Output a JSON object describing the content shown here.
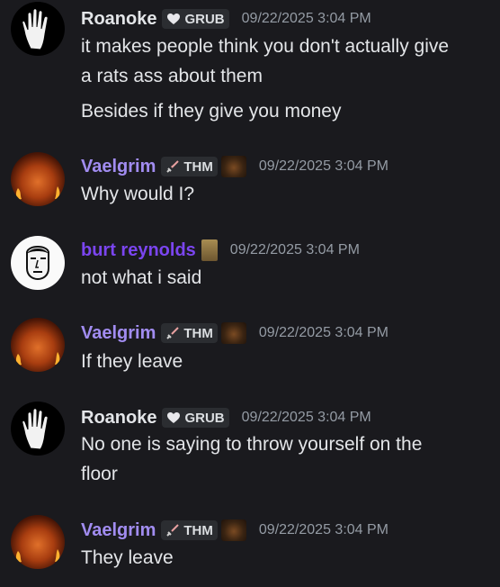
{
  "messages": [
    {
      "author": "Roanoke",
      "author_color": "#e3e5e8",
      "avatar_icon": "white-hand-avatar",
      "tag": {
        "icon": "heart-icon",
        "label": "GRUB"
      },
      "timestamp": "09/22/2025 3:04 PM",
      "lines": [
        "it makes people think you don't actually give",
        "a rats ass about them",
        "Besides if they give you money"
      ]
    },
    {
      "author": "Vaelgrim",
      "author_color": "#a18cf0",
      "avatar_icon": "flaming-orb-avatar",
      "tag": {
        "icon": "sword-icon",
        "label": "THM"
      },
      "timestamp": "09/22/2025 3:04 PM",
      "lines": [
        "Why would I?"
      ]
    },
    {
      "author": "burt reynolds",
      "author_color": "#7b45f0",
      "avatar_icon": "cartoon-face-avatar",
      "tag": {
        "icon": "card-badge-icon",
        "label": ""
      },
      "timestamp": "09/22/2025 3:04 PM",
      "lines": [
        "not what i said"
      ]
    },
    {
      "author": "Vaelgrim",
      "author_color": "#a18cf0",
      "avatar_icon": "flaming-orb-avatar",
      "tag": {
        "icon": "sword-icon",
        "label": "THM"
      },
      "timestamp": "09/22/2025 3:04 PM",
      "lines": [
        "If they leave"
      ]
    },
    {
      "author": "Roanoke",
      "author_color": "#e3e5e8",
      "avatar_icon": "white-hand-avatar",
      "tag": {
        "icon": "heart-icon",
        "label": "GRUB"
      },
      "timestamp": "09/22/2025 3:04 PM",
      "lines": [
        "No one is saying to throw yourself on the",
        "floor"
      ]
    },
    {
      "author": "Vaelgrim",
      "author_color": "#a18cf0",
      "avatar_icon": "flaming-orb-avatar",
      "tag": {
        "icon": "sword-icon",
        "label": "THM"
      },
      "timestamp": "09/22/2025 3:04 PM",
      "lines": [
        "They leave"
      ]
    }
  ]
}
